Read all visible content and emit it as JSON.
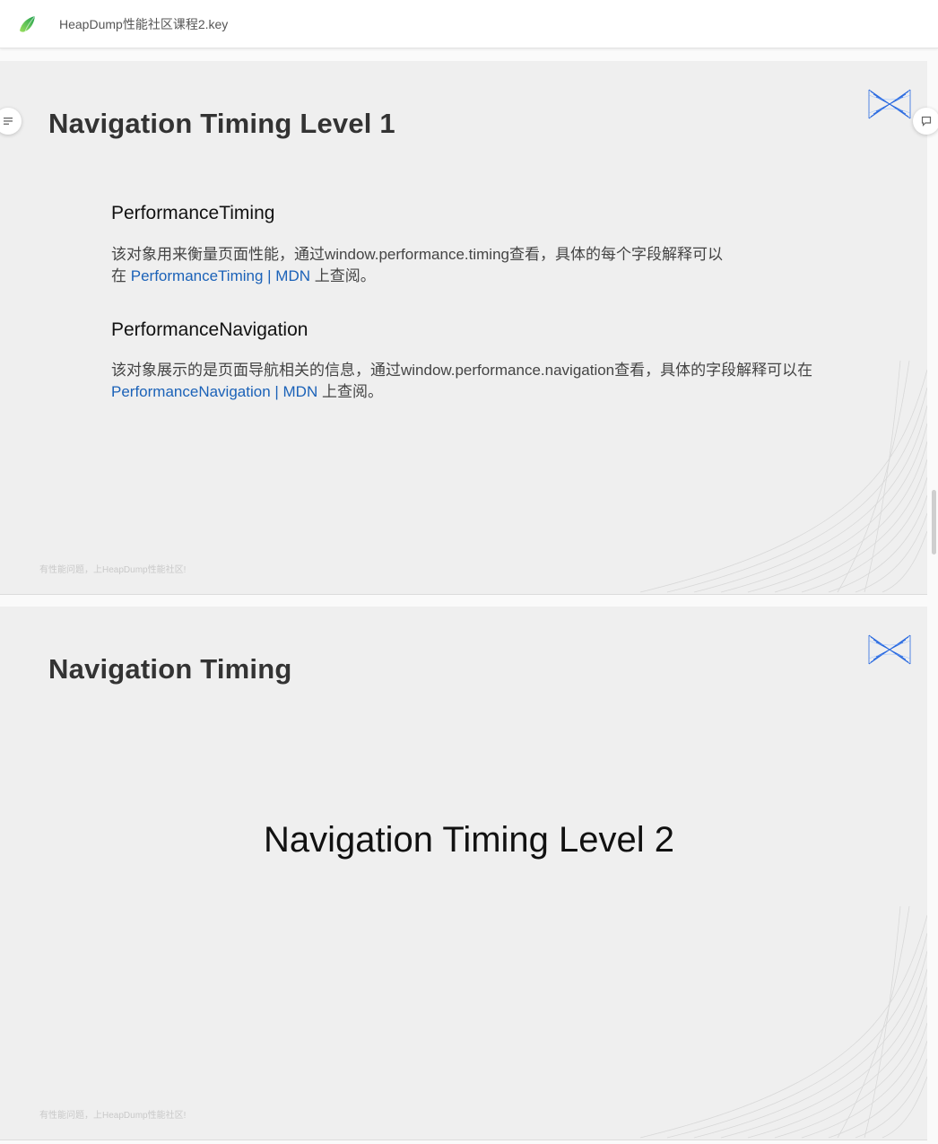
{
  "header": {
    "title": "HeapDump性能社区课程2.key",
    "logo_icon": "bird-logo-icon"
  },
  "slides": [
    {
      "title": "Navigation Timing Level 1",
      "sections": [
        {
          "heading": "PerformanceTiming",
          "line1": "该对象用来衡量页面性能，通过window.performance.timing查看，具体的每个字段解释可以",
          "line2_prefix": "在 ",
          "link": "PerformanceTiming | MDN",
          "line2_suffix": " 上查阅。"
        },
        {
          "heading": "PerformanceNavigation",
          "line1": "该对象展示的是页面导航相关的信息，通过window.performance.navigation查看，具体的字段解释可以在",
          "line2_prefix": "",
          "link": "PerformanceNavigation | MDN",
          "line2_suffix": " 上查阅。"
        }
      ],
      "footer": "有性能问题，上HeapDump性能社区!"
    },
    {
      "title": "Navigation Timing",
      "center_text": "Navigation Timing Level 2",
      "footer": "有性能问题，上HeapDump性能社区!"
    }
  ],
  "colors": {
    "link": "#1b62b8",
    "slide_bg": "#efefef",
    "accent_logo": "#2a6ae0"
  }
}
